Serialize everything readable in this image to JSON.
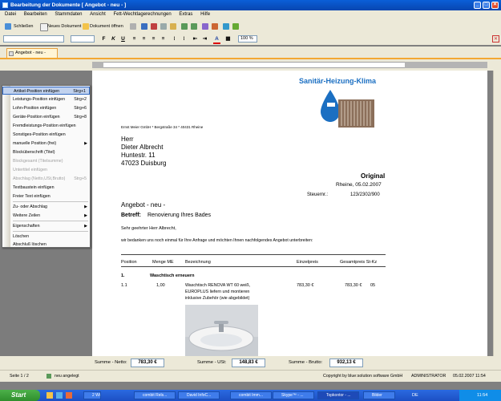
{
  "window": {
    "title": "Bearbeitung der Dokumente [ Angebot - neu - ]",
    "controls": {
      "minimize": "_",
      "maximize": "□",
      "close": "✕"
    }
  },
  "menubar": [
    "Datei",
    "Bearbeiten",
    "Stammdaten",
    "Ansicht",
    "Fett-Wechtlagerechnungen",
    "Extras",
    "Hilfe"
  ],
  "toolbar": {
    "save": "Schließen",
    "new_document": "Neues Dokument",
    "open_document": "Dokument öffnen"
  },
  "format_bar": {
    "zoom": "100 %",
    "bold": "F",
    "italic": "K",
    "underline": "U"
  },
  "doc_tab": "Angebot - neu -",
  "context_menu": {
    "items": [
      {
        "label": "Artikel-Position einfügen",
        "shortcut": "Strg+1",
        "highlighted": true
      },
      {
        "label": "Leistungs-Position einfügen",
        "shortcut": "Strg+2"
      },
      {
        "label": "Lohn-Position einfügen",
        "shortcut": "Strg+6"
      },
      {
        "label": "Geräte-Position einfügen",
        "shortcut": "Strg+8"
      },
      {
        "label": "Fremdleistungs-Position einfügen",
        "shortcut": ""
      },
      {
        "label": "Sonstiges-Position einfügen",
        "shortcut": ""
      },
      {
        "label": "manuelle Position (frei)",
        "shortcut": "",
        "submenu": true
      },
      {
        "label": "Blocküberschrift (Titel)",
        "shortcut": ""
      },
      {
        "label": "Blockgesamt (Titelsumme)",
        "shortcut": "",
        "disabled": true
      },
      {
        "label": "Untertitel einfügen",
        "shortcut": "",
        "disabled": true
      },
      {
        "label": "Abschlag (Netto,USt,Brutto)",
        "shortcut": "Strg+5",
        "disabled": true
      },
      {
        "label": "Textbaustein einfügen",
        "shortcut": ""
      },
      {
        "label": "Freier Text einfügen",
        "shortcut": ""
      },
      {
        "label": "Zu- oder Abschlag",
        "shortcut": "",
        "submenu": true
      },
      {
        "label": "Weitere Zeilen",
        "shortcut": "",
        "submenu": true
      },
      {
        "label": "Eigenschaften",
        "shortcut": "",
        "submenu": true
      },
      {
        "label": "Löschen",
        "shortcut": ""
      },
      {
        "label": "Abschluß löschen",
        "shortcut": ""
      }
    ]
  },
  "document": {
    "company_header": "Sanitär-Heizung-Klima",
    "sender_line": "Ernst Meier GmbH * Bergstraße 34 * 40431 Rheine",
    "recipient": [
      "Herr",
      "Dieter Albrecht",
      "Huntestr. 11",
      "47023 Duisburg"
    ],
    "doc_label": "Original",
    "date_line": "Rheine, 05.02.2007",
    "tax_label": "Steuernr.:",
    "tax_number": "123/2302/900",
    "title": "Angebot - neu -",
    "subject_label": "Betreff:",
    "subject": "Renovierung Ihres Bades",
    "greeting": "Sehr geehrter Herr Albrecht,",
    "intro": "wir bedanken uns noch einmal für Ihre Anfrage und möchten Ihnen nachfolgendes Angebot unterbreiten:",
    "table_headers": {
      "pos": "Position",
      "qty": "Menge ME",
      "desc": "Bezeichnung",
      "unit": "Einzelpreis",
      "total": "Gesamtpreis St-Kz"
    },
    "block": {
      "number": "1.",
      "title": "Waschtisch erneuern"
    },
    "item": {
      "pos": "1.1",
      "qty": "1,00",
      "desc": [
        "Waschtisch RENOVA WT 60 weiß,",
        "EUROPLUS liefern und montieren",
        "inklusive Zubehör (wie abgebildet)"
      ],
      "unit_price": "783,30 €",
      "total_price": "783,30 €",
      "tax_code": "05"
    }
  },
  "totals": {
    "net_label": "Summe - Netto:",
    "net_value": "783,30 €",
    "vat_label": "Summe - USt:",
    "vat_value": "148,83 €",
    "gross_label": "Summe - Brutto:",
    "gross_value": "932,13 €"
  },
  "statusbar": {
    "page": "Seite 1 / 2",
    "state": "neu angelegt",
    "copyright": "Copyright by blue:solution software GmbH",
    "user": "ADMINISTRATOR",
    "timestamp": "05.02.2007 11:54"
  },
  "taskbar": {
    "start": "Start",
    "tasks": [
      "2 Win...",
      "combit Rels...",
      "David InfoC...",
      "combit Imm...",
      "Skype™ - ...",
      "Topkontor - ...",
      "Bilder"
    ],
    "tray_clock": "11:54",
    "language": "DE"
  },
  "colors": {
    "titlebar": "#0a5fd8",
    "header_text": "#1b6fc2",
    "highlight": "#c1d2ee"
  }
}
